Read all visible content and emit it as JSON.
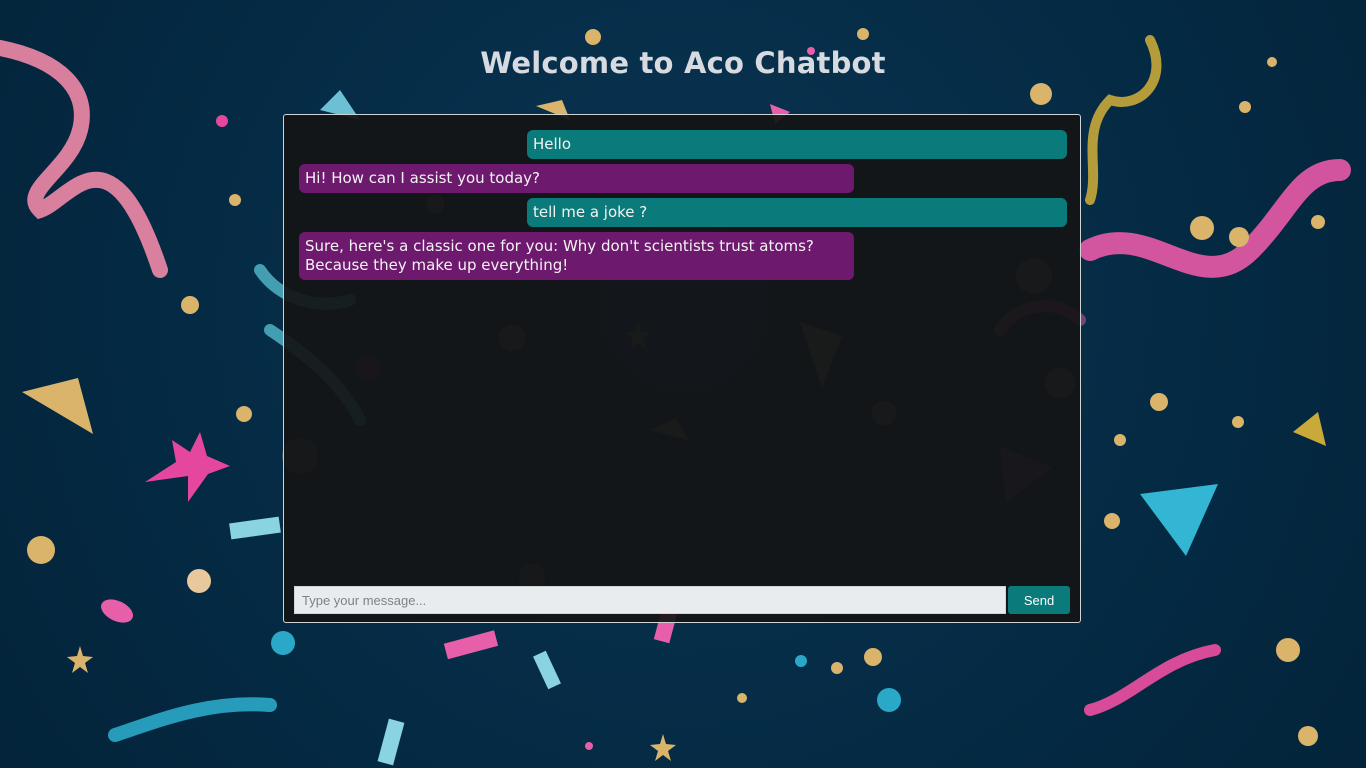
{
  "header": {
    "title": "Welcome to Aco Chatbot"
  },
  "chat": {
    "messages": [
      {
        "role": "user",
        "text": "Hello"
      },
      {
        "role": "bot",
        "text": "Hi! How can I assist you today?"
      },
      {
        "role": "user",
        "text": "tell me a joke ?"
      },
      {
        "role": "bot",
        "text": "Sure, here's a classic one for you: Why don't scientists trust atoms?\nBecause they make up everything!"
      }
    ],
    "input": {
      "value": "",
      "placeholder": "Type your message..."
    },
    "send_label": "Send"
  },
  "colors": {
    "background": "#052b45",
    "user_bubble": "#0b7a7a",
    "bot_bubble": "#6d1a6e",
    "panel": "#141416",
    "send_button": "#0b7a7a"
  }
}
